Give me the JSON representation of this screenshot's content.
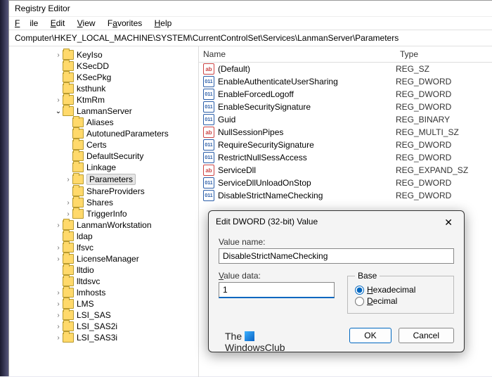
{
  "window": {
    "title": "Registry Editor"
  },
  "menu": {
    "file": "File",
    "edit": "Edit",
    "view": "View",
    "favorites": "Favorites",
    "help": "Help"
  },
  "address": {
    "path": "Computer\\HKEY_LOCAL_MACHINE\\SYSTEM\\CurrentControlSet\\Services\\LanmanServer\\Parameters"
  },
  "tree": {
    "items": [
      {
        "label": "KeyIso",
        "level": 1,
        "exp": "right"
      },
      {
        "label": "KSecDD",
        "level": 1,
        "exp": ""
      },
      {
        "label": "KSecPkg",
        "level": 1,
        "exp": ""
      },
      {
        "label": "ksthunk",
        "level": 1,
        "exp": ""
      },
      {
        "label": "KtmRm",
        "level": 1,
        "exp": "right"
      },
      {
        "label": "LanmanServer",
        "level": 1,
        "exp": "open"
      },
      {
        "label": "Aliases",
        "level": 2,
        "exp": ""
      },
      {
        "label": "AutotunedParameters",
        "level": 2,
        "exp": ""
      },
      {
        "label": "Certs",
        "level": 2,
        "exp": ""
      },
      {
        "label": "DefaultSecurity",
        "level": 2,
        "exp": ""
      },
      {
        "label": "Linkage",
        "level": 2,
        "exp": ""
      },
      {
        "label": "Parameters",
        "level": 2,
        "exp": "right",
        "selected": true
      },
      {
        "label": "ShareProviders",
        "level": 2,
        "exp": ""
      },
      {
        "label": "Shares",
        "level": 2,
        "exp": "right"
      },
      {
        "label": "TriggerInfo",
        "level": 2,
        "exp": "right"
      },
      {
        "label": "LanmanWorkstation",
        "level": 1,
        "exp": "right"
      },
      {
        "label": "ldap",
        "level": 1,
        "exp": ""
      },
      {
        "label": "lfsvc",
        "level": 1,
        "exp": "right"
      },
      {
        "label": "LicenseManager",
        "level": 1,
        "exp": "right"
      },
      {
        "label": "lltdio",
        "level": 1,
        "exp": ""
      },
      {
        "label": "lltdsvc",
        "level": 1,
        "exp": ""
      },
      {
        "label": "lmhosts",
        "level": 1,
        "exp": "right"
      },
      {
        "label": "LMS",
        "level": 1,
        "exp": "right"
      },
      {
        "label": "LSI_SAS",
        "level": 1,
        "exp": "right"
      },
      {
        "label": "LSI_SAS2i",
        "level": 1,
        "exp": "right"
      },
      {
        "label": "LSI_SAS3i",
        "level": 1,
        "exp": "right"
      }
    ]
  },
  "list": {
    "headers": {
      "name": "Name",
      "type": "Type"
    },
    "rows": [
      {
        "icon": "ab",
        "name": "(Default)",
        "type": "REG_SZ"
      },
      {
        "icon": "01",
        "name": "EnableAuthenticateUserSharing",
        "type": "REG_DWORD"
      },
      {
        "icon": "01",
        "name": "EnableForcedLogoff",
        "type": "REG_DWORD"
      },
      {
        "icon": "01",
        "name": "EnableSecuritySignature",
        "type": "REG_DWORD"
      },
      {
        "icon": "01",
        "name": "Guid",
        "type": "REG_BINARY"
      },
      {
        "icon": "ab",
        "name": "NullSessionPipes",
        "type": "REG_MULTI_SZ"
      },
      {
        "icon": "01",
        "name": "RequireSecuritySignature",
        "type": "REG_DWORD"
      },
      {
        "icon": "01",
        "name": "RestrictNullSessAccess",
        "type": "REG_DWORD"
      },
      {
        "icon": "ab",
        "name": "ServiceDll",
        "type": "REG_EXPAND_SZ"
      },
      {
        "icon": "01",
        "name": "ServiceDllUnloadOnStop",
        "type": "REG_DWORD"
      },
      {
        "icon": "01",
        "name": "DisableStrictNameChecking",
        "type": "REG_DWORD"
      }
    ]
  },
  "dialog": {
    "title": "Edit DWORD (32-bit) Value",
    "value_name_label": "Value name:",
    "value_name": "DisableStrictNameChecking",
    "value_data_label": "Value data:",
    "value_data": "1",
    "base_label": "Base",
    "hex_label": "Hexadecimal",
    "dec_label": "Decimal",
    "ok": "OK",
    "cancel": "Cancel",
    "close": "✕"
  },
  "brand": {
    "line1": "The",
    "line2": "WindowsClub"
  }
}
